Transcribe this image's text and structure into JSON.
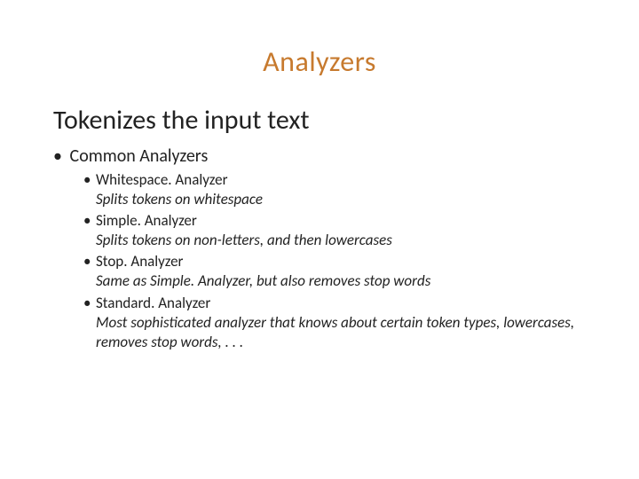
{
  "slide": {
    "title": "Analyzers",
    "subheading": "Tokenizes the input text",
    "section_label": "Common Analyzers",
    "items": [
      {
        "name": "Whitespace. Analyzer",
        "desc": "Splits tokens on whitespace"
      },
      {
        "name": "Simple. Analyzer",
        "desc": "Splits tokens on non-letters, and then lowercases"
      },
      {
        "name": "Stop. Analyzer",
        "desc": "Same as Simple. Analyzer, but also removes stop words"
      },
      {
        "name": "Standard. Analyzer",
        "desc": "Most sophisticated analyzer that knows about certain token types, lowercases, removes stop words, . . ."
      }
    ]
  }
}
